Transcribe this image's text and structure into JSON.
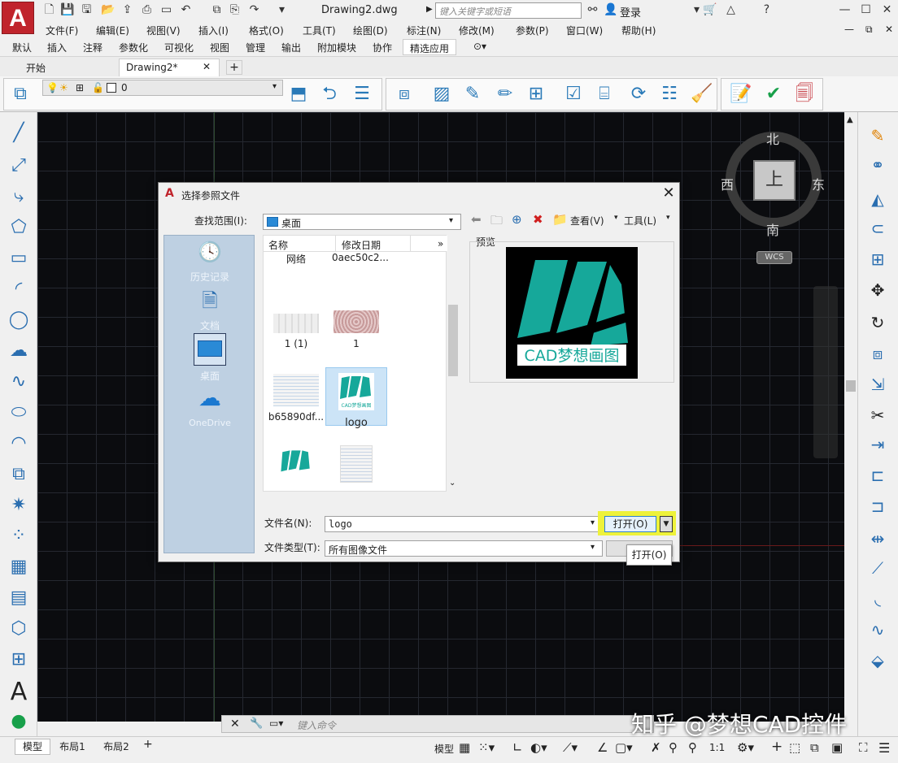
{
  "titlebar": {
    "logo_letter": "A",
    "document_title": "Drawing2.dwg",
    "search_placeholder": "键入关键字或短语",
    "login_label": "登录"
  },
  "menubar": [
    "文件(F)",
    "编辑(E)",
    "视图(V)",
    "插入(I)",
    "格式(O)",
    "工具(T)",
    "绘图(D)",
    "标注(N)",
    "修改(M)",
    "参数(P)",
    "窗口(W)",
    "帮助(H)"
  ],
  "ribbon_tabs": [
    "默认",
    "插入",
    "注释",
    "参数化",
    "可视化",
    "视图",
    "管理",
    "输出",
    "附加模块",
    "协作",
    "精选应用"
  ],
  "ribbon_active_tab": "精选应用",
  "file_tabs": [
    "开始",
    "Drawing2*"
  ],
  "layer_combo_value": "0",
  "viewcube": {
    "north": "北",
    "south": "南",
    "east": "东",
    "west": "西",
    "face": "上",
    "wcs": "WCS"
  },
  "command_placeholder": "键入命令",
  "status": {
    "layout_tabs": [
      "模型",
      "布局1",
      "布局2"
    ],
    "model_label": "模型",
    "scale": "1:1"
  },
  "watermark": "知乎 @梦想CAD控件",
  "dialog": {
    "title": "选择参照文件",
    "look_in_label": "查找范围(I):",
    "look_in_value": "桌面",
    "view_menu": "查看(V)",
    "tools_menu": "工具(L)",
    "places": [
      "历史记录",
      "文档",
      "桌面",
      "OneDrive"
    ],
    "columns": {
      "name": "名称",
      "date": "修改日期"
    },
    "files": [
      {
        "name": "网络",
        "date": "0aec50c2..."
      },
      {
        "name": "1 (1)"
      },
      {
        "name": "1"
      },
      {
        "name": "b65890df..."
      },
      {
        "name": "logo",
        "selected": true
      }
    ],
    "preview_label": "预览",
    "preview_logo_text": "CAD梦想画图",
    "thumb_logo_text": "CAD梦想画图",
    "filename_label": "文件名(N):",
    "filename_value": "logo",
    "filetype_label": "文件类型(T):",
    "filetype_value": "所有图像文件",
    "open_button": "打开(O)",
    "open_tooltip": "打开(O)"
  },
  "colors": {
    "accent": "#c0242c",
    "teal": "#16a89a",
    "canvas": "#0b0c0f",
    "highlight": "#eef23a"
  }
}
